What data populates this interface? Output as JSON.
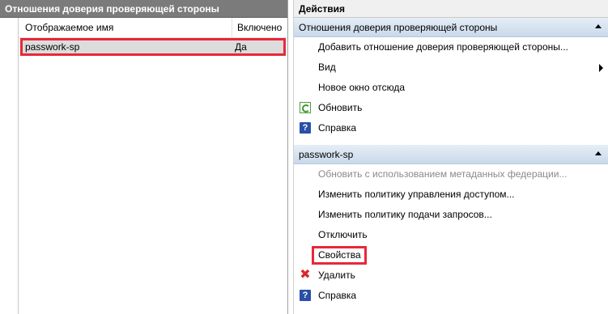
{
  "left": {
    "title": "Отношения доверия проверяющей стороны",
    "columns": {
      "name": "Отображаемое имя",
      "enabled": "Включено"
    },
    "rows": [
      {
        "name": "passwork-sp",
        "enabled": "Да"
      }
    ]
  },
  "actions": {
    "title": "Действия",
    "group1": {
      "title": "Отношения доверия проверяющей стороны",
      "items": [
        {
          "label": "Добавить отношение доверия проверяющей стороны..."
        },
        {
          "label": "Вид"
        },
        {
          "label": "Новое окно отсюда"
        },
        {
          "label": "Обновить",
          "icon": "refresh-icon"
        },
        {
          "label": "Справка",
          "icon": "help-icon"
        }
      ]
    },
    "group2": {
      "title": "passwork-sp",
      "items": [
        {
          "label": "Обновить с использованием метаданных федерации..."
        },
        {
          "label": "Изменить политику управления доступом..."
        },
        {
          "label": "Изменить политику подачи запросов..."
        },
        {
          "label": "Отключить"
        },
        {
          "label": "Свойства"
        },
        {
          "label": "Удалить",
          "icon": "delete-icon"
        },
        {
          "label": "Справка",
          "icon": "help-icon"
        }
      ]
    }
  },
  "colors": {
    "highlight": "#e8283a",
    "header_gray": "#7b7b7b",
    "group_blue": "#c9d9ea"
  }
}
